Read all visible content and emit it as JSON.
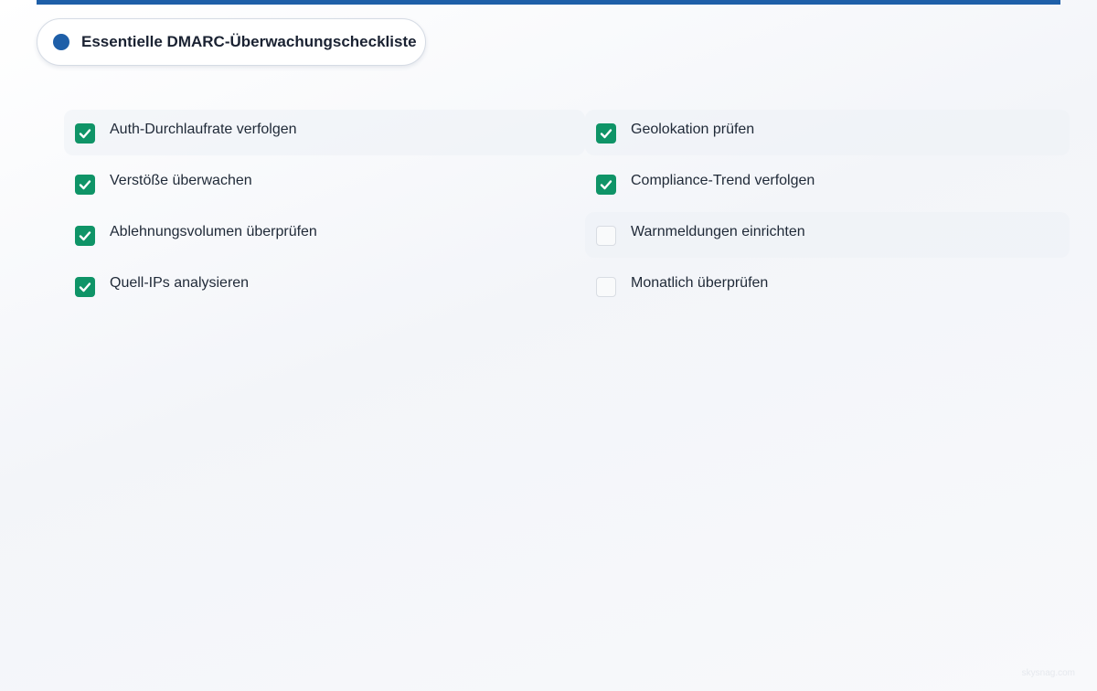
{
  "header": {
    "title": "Essentielle DMARC-Überwachungscheckliste",
    "accent_color": "#1e5fa8"
  },
  "checklist": {
    "checked_color": "#0f9467",
    "items": [
      {
        "label": "Auth-Durchlaufrate verfolgen",
        "checked": true,
        "highlighted": true
      },
      {
        "label": "Geolokation prüfen",
        "checked": true,
        "highlighted": true
      },
      {
        "label": "Verstöße überwachen",
        "checked": true,
        "highlighted": false
      },
      {
        "label": "Compliance-Trend verfolgen",
        "checked": true,
        "highlighted": false
      },
      {
        "label": "Ablehnungsvolumen überprüfen",
        "checked": true,
        "highlighted": false
      },
      {
        "label": "Warnmeldungen einrichten",
        "checked": false,
        "highlighted": true
      },
      {
        "label": "Quell-IPs analysieren",
        "checked": true,
        "highlighted": false
      },
      {
        "label": "Monatlich überprüfen",
        "checked": false,
        "highlighted": false
      }
    ]
  },
  "footer": {
    "watermark": "skysnag.com"
  }
}
